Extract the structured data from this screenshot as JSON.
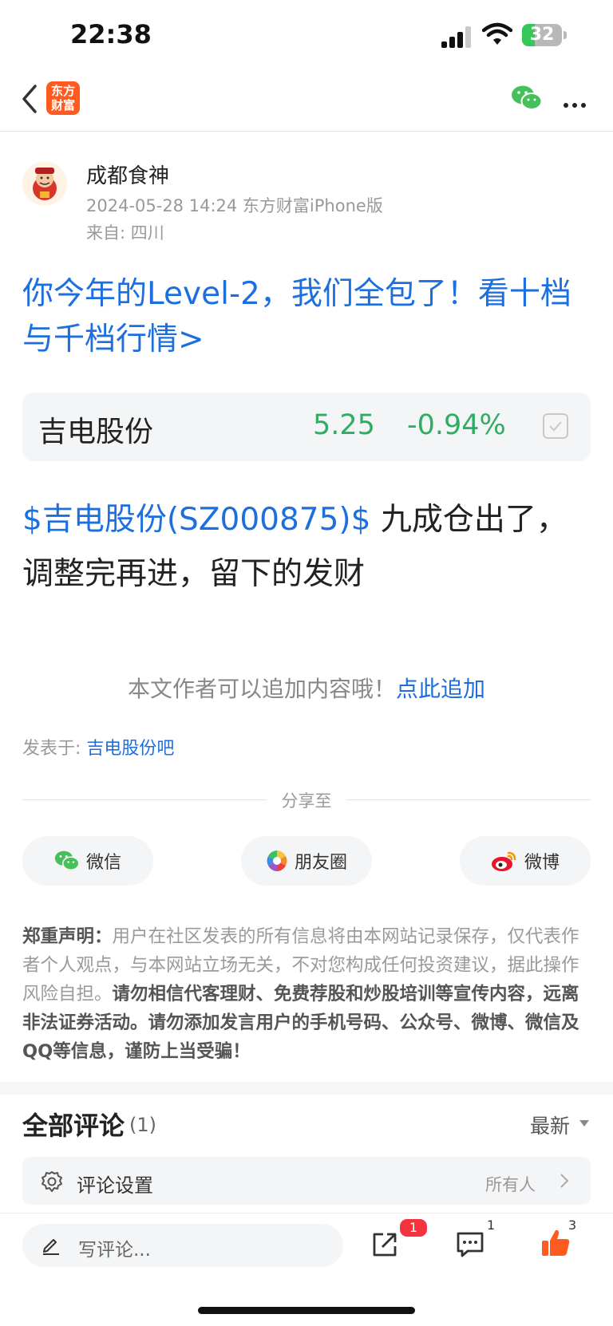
{
  "status_bar": {
    "time": "22:38",
    "battery": "32"
  },
  "nav": {
    "logo_line1": "东方",
    "logo_line2": "财富"
  },
  "author": {
    "name": "成都食神",
    "meta": "2024-05-28 14:24 东方财富iPhone版",
    "location": "来自: 四川"
  },
  "promo_text": "你今年的Level-2，我们全包了！看十档与千档行情>",
  "stock": {
    "name": "吉电股份",
    "price": "5.25",
    "change": "-0.94%"
  },
  "post": {
    "tag": "$吉电股份(SZ000875)$",
    "text": " 九成仓出了，调整完再进，留下的发财"
  },
  "append_hint": {
    "text": "本文作者可以追加内容哦！",
    "link": "点此追加"
  },
  "posted_in": {
    "label": "发表于: ",
    "link": "吉电股份吧"
  },
  "share": {
    "title": "分享至",
    "buttons": [
      {
        "label": "微信",
        "icon": "wechat-icon"
      },
      {
        "label": "朋友圈",
        "icon": "moments-icon"
      },
      {
        "label": "微博",
        "icon": "weibo-icon"
      }
    ]
  },
  "disclaimer": {
    "title": "郑重声明：",
    "normal": "用户在社区发表的所有信息将由本网站记录保存，仅代表作者个人观点，与本网站立场无关，不对您构成任何投资建议，据此操作风险自担。",
    "bold": "请勿相信代客理财、免费荐股和炒股培训等宣传内容，远离非法证券活动。请勿添加发言用户的手机号码、公众号、微博、微信及QQ等信息，谨防上当受骗！"
  },
  "comments": {
    "title": "全部评论",
    "count": "(1)",
    "sort": "最新",
    "settings_label": "评论设置",
    "settings_value": "所有人"
  },
  "bottom_bar": {
    "write_placeholder": "写评论...",
    "share_badge": "1",
    "comment_count": "1",
    "like_count": "3"
  },
  "colors": {
    "link": "#1d6fdf",
    "down": "#2fae63",
    "brand": "#ff5a1f",
    "badge": "#f5333f"
  }
}
